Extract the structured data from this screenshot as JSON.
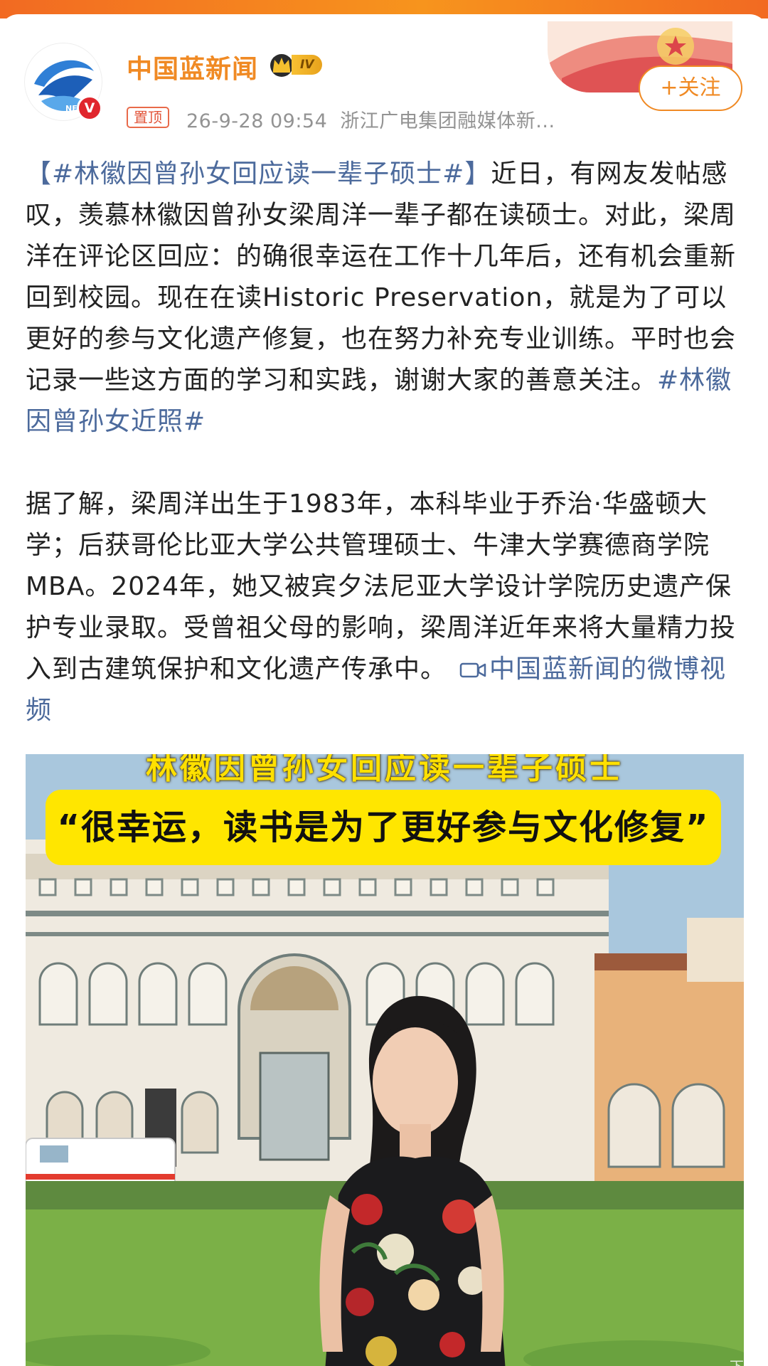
{
  "author": {
    "name": "中国蓝新闻",
    "vip_level": "IV",
    "verified_mark": "V",
    "avatar_text": "NEWS"
  },
  "post": {
    "pinned_label": "置顶",
    "timestamp": "26-9-28 09:54",
    "source": "浙江广电集团融媒体新..."
  },
  "follow_button_label": "+关注",
  "content": {
    "hashtag_1": "【#林徽因曾孙女回应读一辈子硕士#】",
    "paragraph_1": "近日，有网友发帖感叹，羡慕林徽因曾孙女梁周洋一辈子都在读硕士。对此，梁周洋在评论区回应：的确很幸运在工作十几年后，还有机会重新回到校园。现在在读Historic Preservation，就是为了可以更好的参与文化遗产修复，也在努力补充专业训练。平时也会记录一些这方面的学习和实践，谢谢大家的善意关注。",
    "hashtag_2": "#林徽因曾孙女近照#",
    "paragraph_2": "据了解，梁周洋出生于1983年，本科毕业于乔治·华盛顿大学；后获哥伦比亚大学公共管理硕士、牛津大学赛德商学院MBA。2024年，她又被宾夕法尼亚大学设计学院历史遗产保护专业录取。受曾祖父母的影响，梁周洋近年来将大量精力投入到古建筑保护和文化遗产传承中。",
    "video_link_label": "中国蓝新闻的微博视频"
  },
  "media": {
    "headline": "林徽因曾孙女回应读一辈子硕士",
    "banner_quote": "“很幸运，读书是为了更好参与文化修复”",
    "watermark": "下"
  },
  "icons": {
    "video": "video-camera-icon",
    "crown": "crown-icon"
  },
  "colors": {
    "accent": "#f08a24",
    "link": "#4c6a9c",
    "banner": "#ffe600"
  }
}
